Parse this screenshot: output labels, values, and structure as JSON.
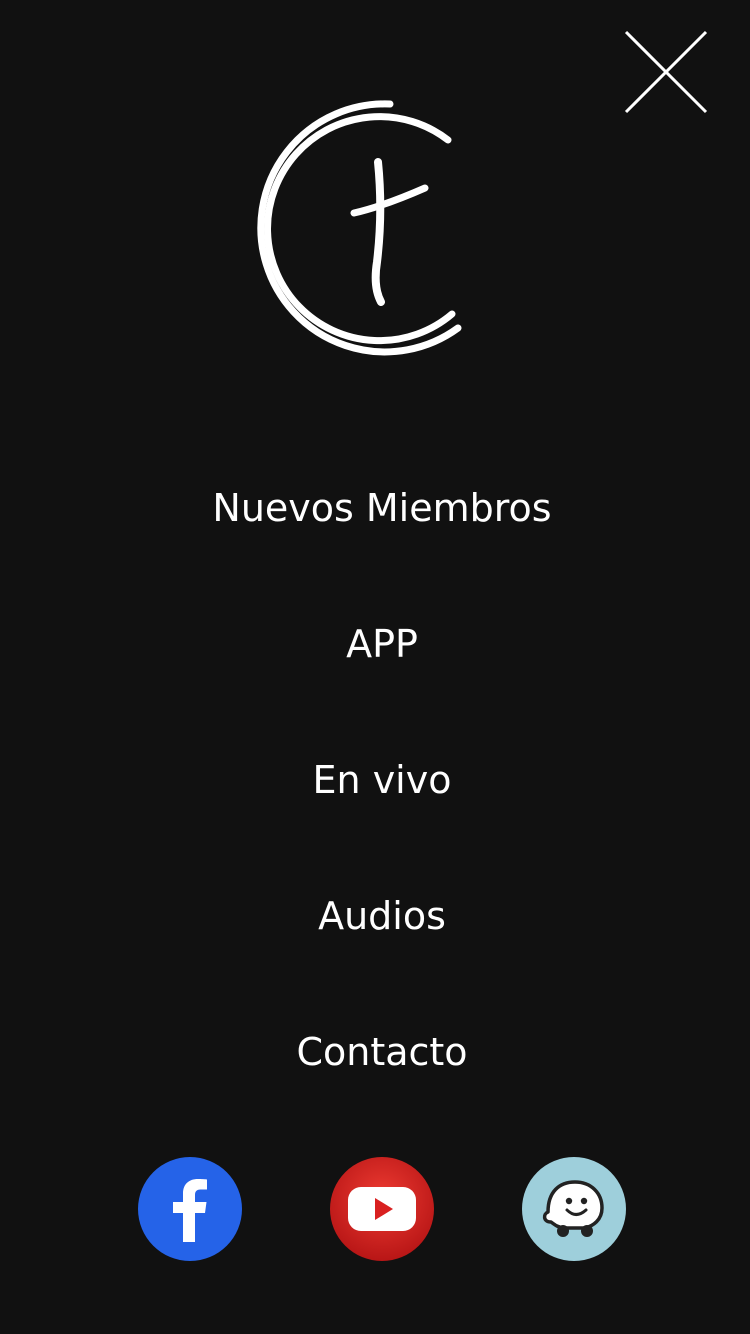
{
  "menu": {
    "items": [
      {
        "label": "Nuevos Miembros"
      },
      {
        "label": "APP"
      },
      {
        "label": "En vivo"
      },
      {
        "label": "Audios"
      },
      {
        "label": "Contacto"
      }
    ]
  },
  "icons": {
    "close": "close-icon",
    "logo": "church-logo-cross",
    "social": [
      "facebook-icon",
      "youtube-icon",
      "waze-icon"
    ]
  },
  "colors": {
    "background": "#111111",
    "text": "#ffffff",
    "facebook": "#2563e8",
    "youtube": "#d92020",
    "waze": "#9ecfdb"
  }
}
